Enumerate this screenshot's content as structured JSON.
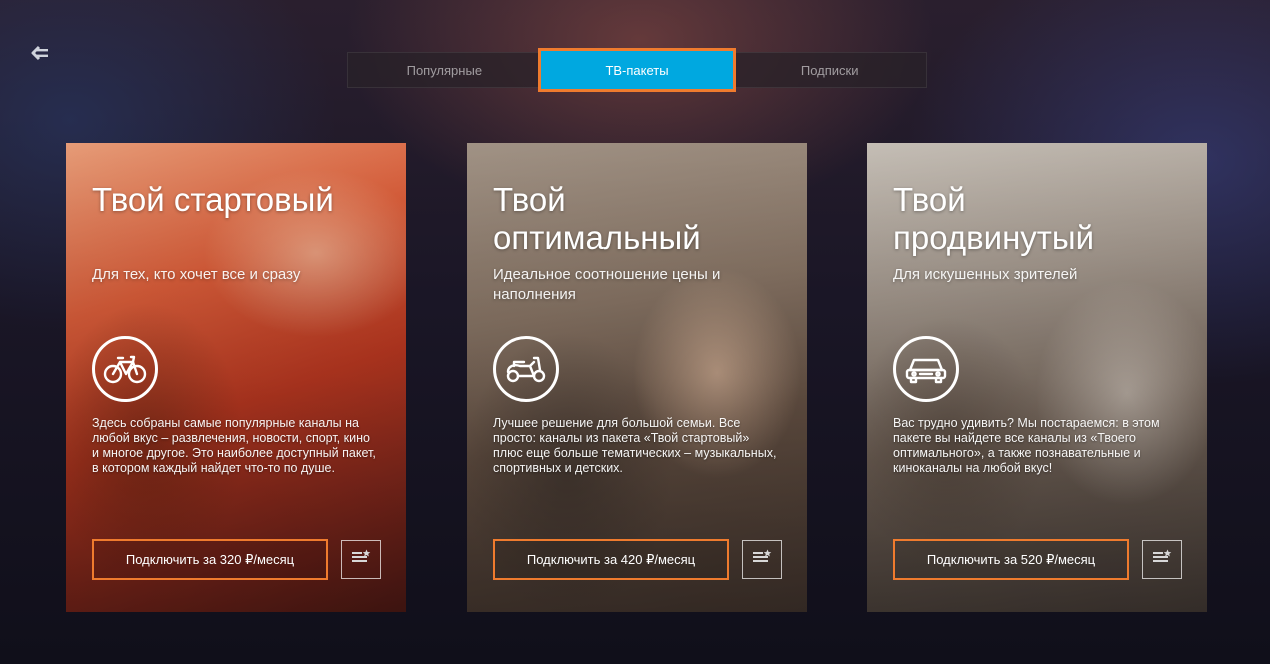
{
  "nav": {
    "back_icon": "back-arrow-icon"
  },
  "tabs": [
    {
      "label": "Популярные",
      "active": false
    },
    {
      "label": "ТВ-пакеты",
      "active": true
    },
    {
      "label": "Подписки",
      "active": false
    }
  ],
  "colors": {
    "accent_blue": "#00a8e0",
    "accent_orange": "#ef7b2e"
  },
  "packages": [
    {
      "title": "Твой стартовый",
      "subtitle": "Для тех, кто хочет все и сразу",
      "icon": "bicycle-icon",
      "description": "Здесь собраны самые популярные каналы на любой вкус – развлечения, новости, спорт, кино и многое другое. Это наиболее доступный пакет, в котором каждый найдет что-то по душе.",
      "button_label": "Подключить за 320 ₽/месяц",
      "info_icon": "channel-list-icon"
    },
    {
      "title": "Твой оптимальный",
      "subtitle": "Идеальное соотношение цены и наполнения",
      "icon": "scooter-icon",
      "description": "Лучшее решение для большой семьи. Все просто: каналы из пакета «Твой стартовый» плюс еще больше тематических – музыкальных, спортивных и детских.",
      "button_label": "Подключить за 420 ₽/месяц",
      "info_icon": "channel-list-icon"
    },
    {
      "title": "Твой продвинутый",
      "subtitle": "Для искушенных зрителей",
      "icon": "car-icon",
      "description": "Вас трудно удивить? Мы постараемся: в этом пакете вы найдете все каналы из «Твоего оптимального», а также познавательные и киноканалы на любой вкус!",
      "button_label": "Подключить за 520 ₽/месяц",
      "info_icon": "channel-list-icon"
    }
  ]
}
